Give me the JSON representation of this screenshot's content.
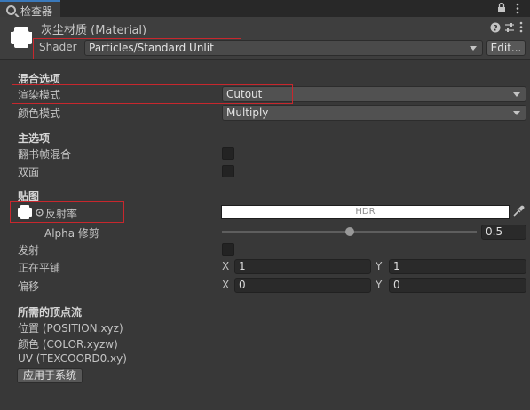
{
  "tab": {
    "label": "检查器"
  },
  "material": {
    "title": "灰尘材质 (Material)",
    "shader_label": "Shader",
    "shader_value": "Particles/Standard Unlit",
    "edit_button": "Edit..."
  },
  "sections": {
    "blending": "混合选项",
    "main": "主选项",
    "maps": "贴图",
    "vertex_streams": "所需的顶点流"
  },
  "blending": {
    "render_mode_label": "渲染模式",
    "render_mode_value": "Cutout",
    "color_mode_label": "颜色模式",
    "color_mode_value": "Multiply"
  },
  "main_options": {
    "flipbook_label": "翻书帧混合",
    "flipbook_checked": false,
    "two_sided_label": "双面",
    "two_sided_checked": false
  },
  "maps": {
    "albedo_label": "反射率",
    "albedo_bar_text": "HDR",
    "alpha_label": "Alpha 修剪",
    "alpha_value": "0.5",
    "emission_label": "发射",
    "emission_checked": false,
    "tiling_label": "正在平铺",
    "offset_label": "偏移",
    "x_label": "X",
    "y_label": "Y",
    "tiling_x": "1",
    "tiling_y": "1",
    "offset_x": "0",
    "offset_y": "0"
  },
  "streams": {
    "position": "位置 (POSITION.xyz)",
    "color": "颜色 (COLOR.xyzw)",
    "uv": "UV (TEXCOORD0.xy)",
    "apply_button": "应用于系统"
  },
  "colors": {
    "background": "#383838",
    "highlight_box": "#c8272d",
    "tab_accent": "#3a79bb"
  }
}
